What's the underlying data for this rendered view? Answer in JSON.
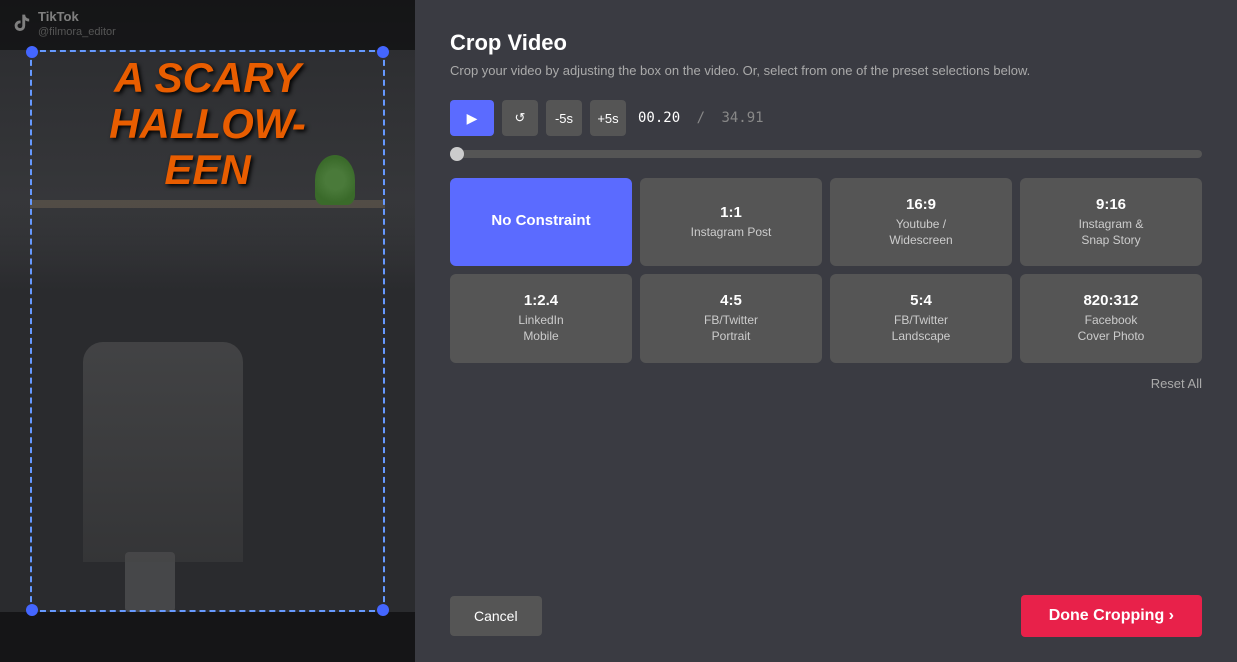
{
  "header": {
    "tiktok_label": "TikTok",
    "handle": "@filmora_editor"
  },
  "panel": {
    "title": "Crop Video",
    "subtitle": "Crop your video by adjusting the box on the video. Or, select from one of the preset selections below."
  },
  "controls": {
    "minus5_label": "-5s",
    "plus5_label": "+5s",
    "current_time": "00.20",
    "separator": "/",
    "total_time": "34.91"
  },
  "crop_options": [
    {
      "ratio": "No Constraint",
      "name": "",
      "active": true
    },
    {
      "ratio": "1:1",
      "name": "Instagram Post",
      "active": false
    },
    {
      "ratio": "16:9",
      "name": "Youtube /\nWidescreen",
      "active": false
    },
    {
      "ratio": "9:16",
      "name": "Instagram &\nSnap Story",
      "active": false
    },
    {
      "ratio": "1:2.4",
      "name": "LinkedIn\nMobile",
      "active": false
    },
    {
      "ratio": "4:5",
      "name": "FB/Twitter\nPortrait",
      "active": false
    },
    {
      "ratio": "5:4",
      "name": "FB/Twitter\nLandscape",
      "active": false
    },
    {
      "ratio": "820:312",
      "name": "Facebook\nCover Photo",
      "active": false
    }
  ],
  "buttons": {
    "reset_all": "Reset All",
    "cancel": "Cancel",
    "done_cropping": "Done Cropping ›"
  },
  "icons": {
    "play": "▶",
    "replay": "↺",
    "chevron_right": "›"
  }
}
